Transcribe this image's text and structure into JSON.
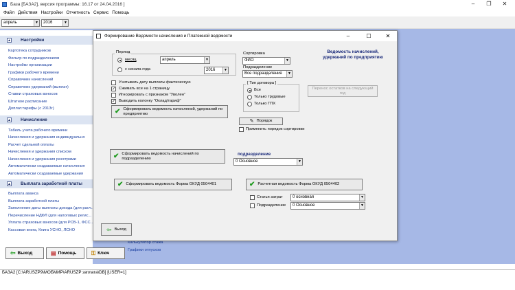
{
  "window": {
    "title": "База [БАЗА2], версия программы: 16.17 от 24.04.2016 ]"
  },
  "menu": [
    "Файл",
    "Действия",
    "Настройки",
    "Отчетность",
    "Сервис",
    "Помощь"
  ],
  "toolbar": {
    "month": "апрель",
    "year": "2016"
  },
  "left_panel": {
    "sections": [
      {
        "title": "Настройки",
        "items": [
          "Картотека сотрудников",
          "Фильтр по подразделениям",
          "Настройки организации",
          "Графики рабочего времени",
          "Справочник начислений",
          "Справочник удержаний (выплат)",
          "Ставки страховых взносов",
          "Штатное расписание",
          "Доплат.тарифы (с 2013г)"
        ]
      },
      {
        "title": "Начисление",
        "items": [
          "Табель учета рабочего времени",
          "Начисления и удержания индивидуально",
          "Расчет сдельной оплаты",
          "Начисления и удержания списком",
          "Начисления и удержания реестрами",
          "Автоматически создаваемые начисления",
          "Автоматически создаваемые удержания"
        ]
      },
      {
        "title": "Выплата заработной платы",
        "items": [
          "Выплата аванса",
          "Выплата заработной платы",
          "Заполнение даты выплаты дохода (для расч...",
          "Перечисление НДФЛ (для налоговых регис...",
          "Уплата страховых взносов (для РСВ-1, ФСС...",
          "Кассовая книга, Книга УСНО, ЛСНО"
        ]
      }
    ],
    "extra_items": [
      "Калькулятор стажа",
      "Графики отпусков"
    ]
  },
  "bottom_buttons": {
    "exit": "Выход",
    "help": "Помощь",
    "key": "Ключ"
  },
  "status_bar": "БАЗА2 [C:\\ARUSZP9\\МОБМИР\\ARUSZP эзплата\\DB] [USER=1]",
  "dialog": {
    "title": "Формирование Ведомости начисления и Платежной ведомости",
    "period": {
      "label": "Период",
      "month_radio": "месяц",
      "month_value": "апрель",
      "from_year_radio": "с начала года",
      "year_value": "2016"
    },
    "sort": {
      "label": "Сортировка",
      "value": "ФИО"
    },
    "division": {
      "label": "Подразделение",
      "value": "Все подразделения"
    },
    "contract_group": {
      "label": "[ Тип договора ]",
      "options": [
        "Все",
        "Только трудовые",
        "Только ГПХ"
      ]
    },
    "header_note": "Ведомость начислений, удержаний по предприятию",
    "checkboxes": [
      {
        "label": "Учитывать дату выплаты фактическую",
        "checked": false
      },
      {
        "label": "Сжимать все на 1 страницу",
        "checked": true
      },
      {
        "label": "Игнорировать с признаком \"Уволен\"",
        "checked": false
      },
      {
        "label": "Выводить колонку \"Оклад/тариф\"",
        "checked": true
      }
    ],
    "btn_form_enterprise": "Сформировать ведомость начислений, удержаний по предприятию",
    "btn_transfer_remains": "Перенос остатков на следующий год",
    "btn_order": "Порядок",
    "apply_sort_order": "Применить порядок сортировки",
    "btn_form_division": "Сформировать ведомость начислений по подразделению",
    "division_label": "подразделение",
    "division_value": "0 Основное",
    "btn_form_0504401": "Сформировать ведомость Форма ОКУД 0504401",
    "btn_payment_0504402": "Расчетная ведомость Форма ОКУД 0504402",
    "expense_item": {
      "label": "Статья затрат",
      "value": "0 основная"
    },
    "subdivision": {
      "label": "Подразделение",
      "value": "0 Основное"
    },
    "btn_exit": "Выход"
  },
  "colors": {
    "workspace": "#a6b8e6",
    "accent": "#1a3fa0",
    "check": "#1d9a1d"
  }
}
